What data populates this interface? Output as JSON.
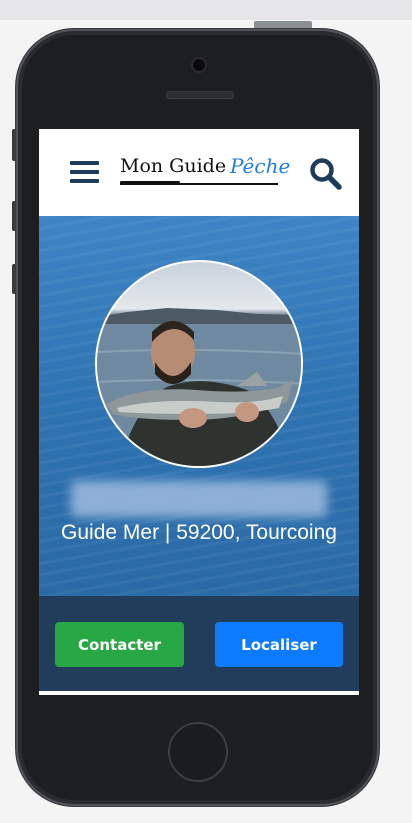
{
  "header": {
    "logo_text": "Mon Guide",
    "logo_accent": "Pêche"
  },
  "profile": {
    "name": "",
    "subtitle": "Guide Mer | 59200, Tourcoing"
  },
  "actions": {
    "contact_label": "Contacter",
    "locate_label": "Localiser"
  },
  "colors": {
    "nav_icon": "#1d3b5a",
    "hero_blue": "#2f74b3",
    "actions_bg": "#223d5b",
    "contact_green": "#28a745",
    "locate_blue": "#0d7bff",
    "logo_accent": "#1e7ed6"
  },
  "icons": {
    "menu": "hamburger-menu-icon",
    "search": "search-icon"
  }
}
